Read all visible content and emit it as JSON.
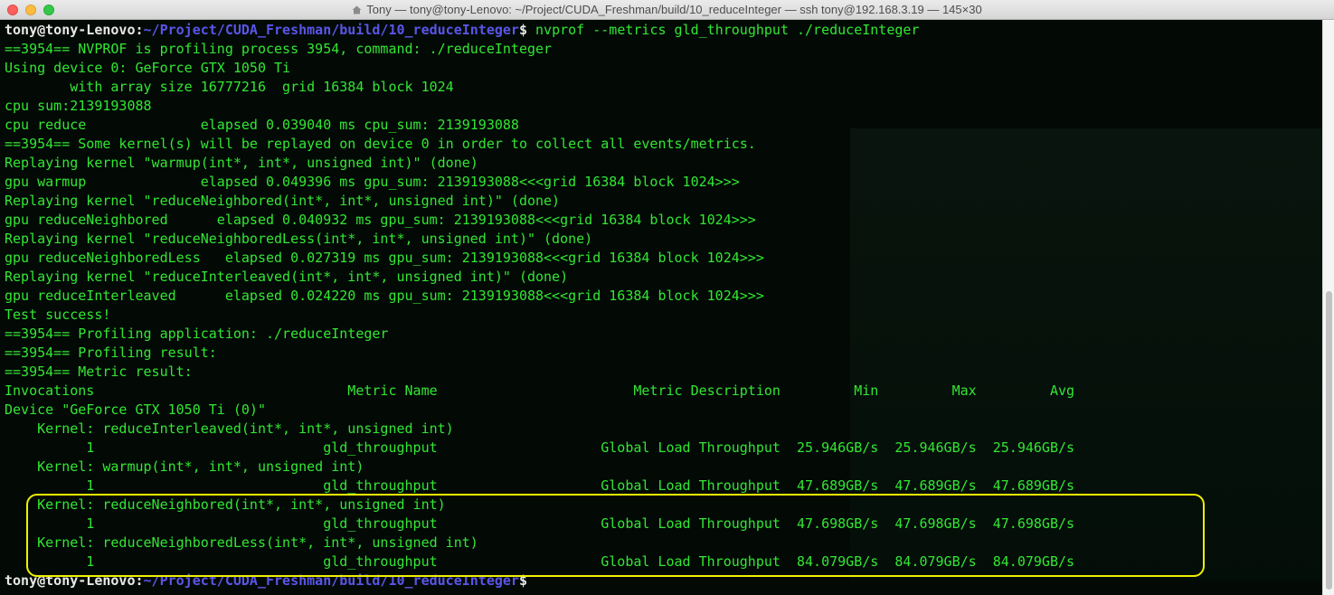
{
  "window": {
    "title": "Tony — tony@tony-Lenovo: ~/Project/CUDA_Freshman/build/10_reduceInteger — ssh tony@192.168.3.19 — 145×30",
    "title_icon": "home-icon"
  },
  "terminal": {
    "prompt_user": "tony@tony-Lenovo",
    "prompt_sep": ":",
    "prompt_path": "~/Project/CUDA_Freshman/build/10_reduceInteger",
    "prompt_dollar": "$",
    "command": " nvprof --metrics gld_throughput ./reduceInteger",
    "output_lines": [
      "==3954== NVPROF is profiling process 3954, command: ./reduceInteger",
      "Using device 0: GeForce GTX 1050 Ti",
      "        with array size 16777216  grid 16384 block 1024",
      "cpu sum:2139193088",
      "cpu reduce              elapsed 0.039040 ms cpu_sum: 2139193088",
      "==3954== Some kernel(s) will be replayed on device 0 in order to collect all events/metrics.",
      "Replaying kernel \"warmup(int*, int*, unsigned int)\" (done)",
      "gpu warmup              elapsed 0.049396 ms gpu_sum: 2139193088<<<grid 16384 block 1024>>>",
      "Replaying kernel \"reduceNeighbored(int*, int*, unsigned int)\" (done)",
      "gpu reduceNeighbored      elapsed 0.040932 ms gpu_sum: 2139193088<<<grid 16384 block 1024>>>",
      "Replaying kernel \"reduceNeighboredLess(int*, int*, unsigned int)\" (done)",
      "gpu reduceNeighboredLess   elapsed 0.027319 ms gpu_sum: 2139193088<<<grid 16384 block 1024>>>",
      "Replaying kernel \"reduceInterleaved(int*, int*, unsigned int)\" (done)",
      "gpu reduceInterleaved      elapsed 0.024220 ms gpu_sum: 2139193088<<<grid 16384 block 1024>>>",
      "Test success!",
      "==3954== Profiling application: ./reduceInteger",
      "==3954== Profiling result:",
      "==3954== Metric result:",
      "Invocations                               Metric Name                        Metric Description         Min         Max         Avg",
      "Device \"GeForce GTX 1050 Ti (0)\"",
      "    Kernel: reduceInterleaved(int*, int*, unsigned int)",
      "          1                            gld_throughput                    Global Load Throughput  25.946GB/s  25.946GB/s  25.946GB/s",
      "    Kernel: warmup(int*, int*, unsigned int)",
      "          1                            gld_throughput                    Global Load Throughput  47.689GB/s  47.689GB/s  47.689GB/s",
      "    Kernel: reduceNeighbored(int*, int*, unsigned int)",
      "          1                            gld_throughput                    Global Load Throughput  47.698GB/s  47.698GB/s  47.698GB/s",
      "    Kernel: reduceNeighboredLess(int*, int*, unsigned int)",
      "          1                            gld_throughput                    Global Load Throughput  84.079GB/s  84.079GB/s  84.079GB/s"
    ],
    "final_prompt_user": "tony@tony-Lenovo",
    "final_prompt_sep": ":",
    "final_prompt_path": "~/Project/CUDA_Freshman/build/10_reduceInteger",
    "final_prompt_dollar": "$"
  },
  "colors": {
    "output_text": "#33e633",
    "prompt_user": "#e8e8e8",
    "prompt_path": "#5a55e8",
    "highlight_box": "#f0f000",
    "background": "#000000"
  }
}
